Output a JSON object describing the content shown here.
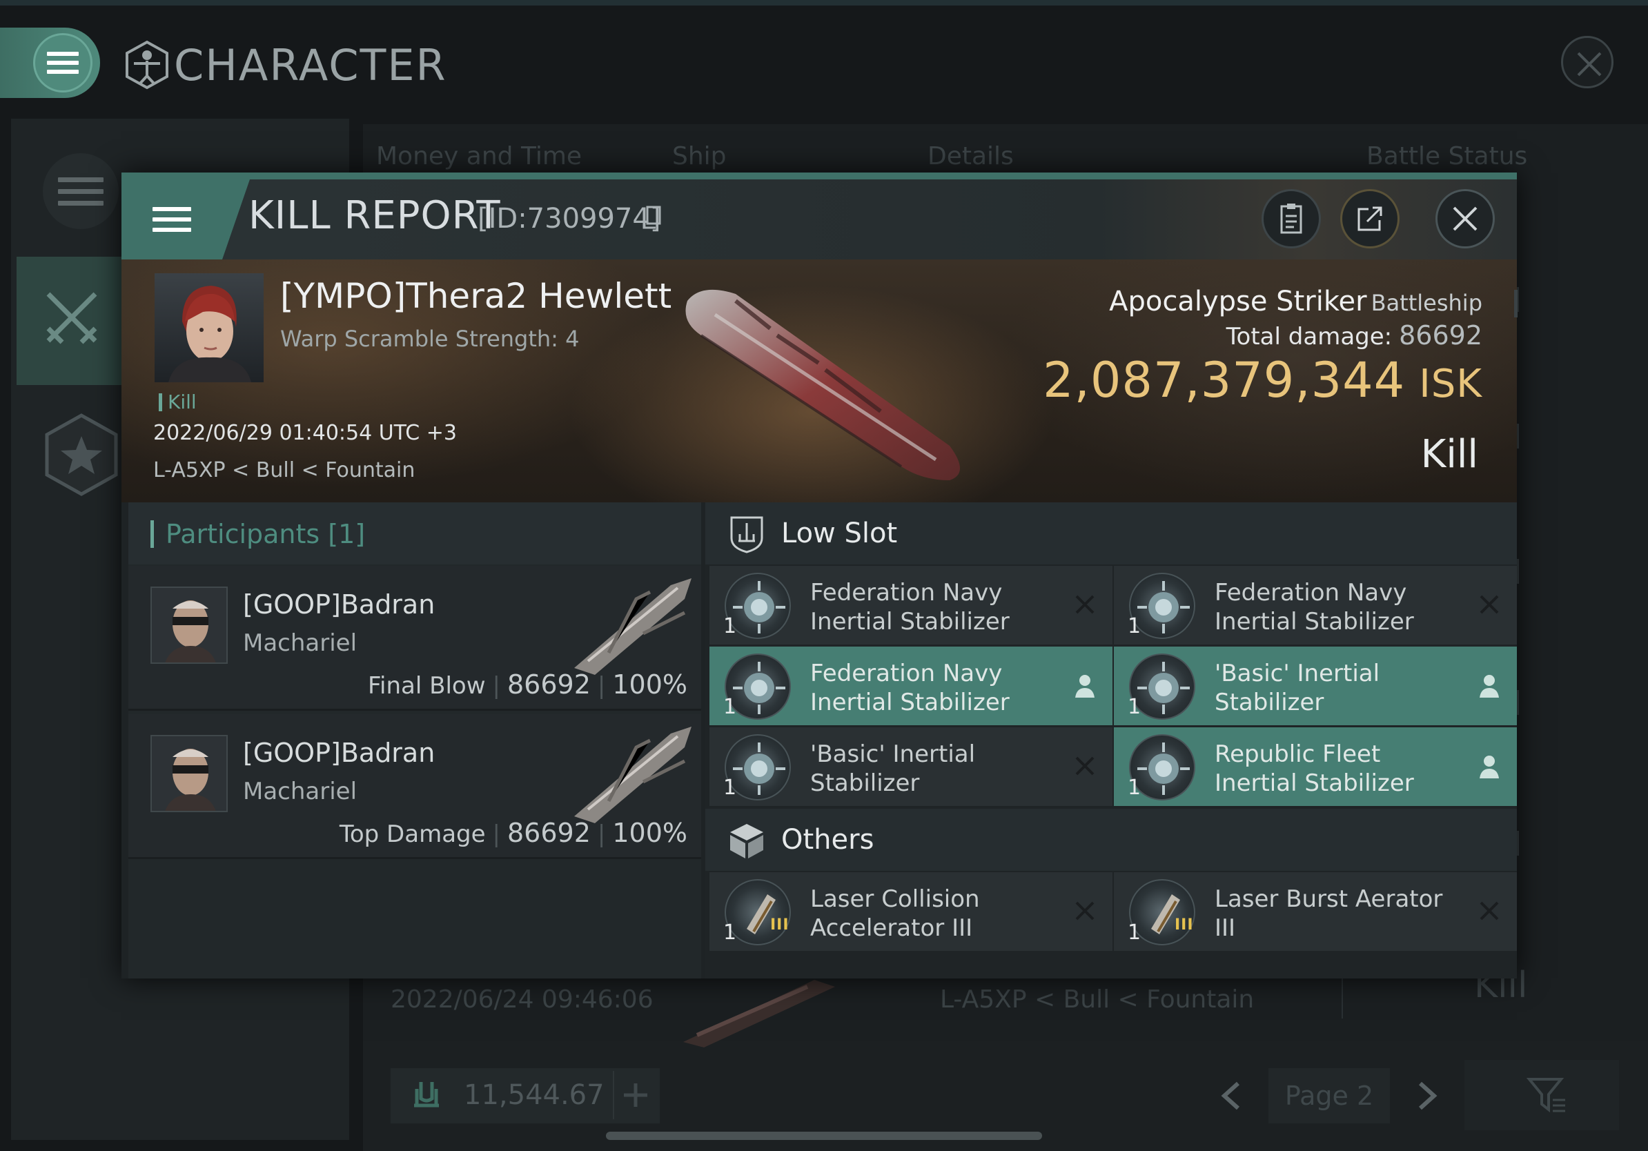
{
  "app": {
    "title": "CHARACTER",
    "tabs": [
      "Money and Time",
      "Ship",
      "Details",
      "Battle Status"
    ],
    "background_row": {
      "date": "2022/06/24  09:46:06",
      "location": "L-A5XP < Bull < Fountain",
      "result": "Kill"
    },
    "wallet_value": "11,544.67",
    "page_label": "Page 2"
  },
  "kill_report": {
    "title": "KILL REPORT",
    "id": "[ID:7309974]",
    "victim": {
      "name": "[YMPO]Thera2 Hewlett",
      "warp_scramble": "Warp Scramble Strength: 4",
      "tag": "Kill",
      "datetime": "2022/06/29 01:40:54 UTC +3",
      "location": "L-A5XP < Bull < Fountain"
    },
    "ship": {
      "name": "Apocalypse Striker",
      "class": "Battleship",
      "total_damage_label": "Total damage:",
      "total_damage": "86692",
      "isk_value": "2,087,379,344",
      "isk_unit": "ISK",
      "result": "Kill"
    },
    "participants": {
      "header": "Participants [1]",
      "rows": [
        {
          "name": "[GOOP]Badran",
          "ship": "Machariel",
          "role": "Final Blow",
          "damage": "86692",
          "percent": "100%"
        },
        {
          "name": "[GOOP]Badran",
          "ship": "Machariel",
          "role": "Top Damage",
          "damage": "86692",
          "percent": "100%"
        }
      ]
    },
    "low_slot": {
      "header": "Low Slot",
      "items": [
        {
          "qty": "1",
          "name": "Federation Navy Inertial Stabilizer",
          "status": "destroyed"
        },
        {
          "qty": "1",
          "name": "Federation Navy Inertial Stabilizer",
          "status": "destroyed"
        },
        {
          "qty": "1",
          "name": "Federation Navy Inertial Stabilizer",
          "status": "dropped"
        },
        {
          "qty": "1",
          "name": "'Basic' Inertial Stabilizer",
          "status": "dropped"
        },
        {
          "qty": "1",
          "name": "'Basic' Inertial Stabilizer",
          "status": "destroyed"
        },
        {
          "qty": "1",
          "name": "Republic Fleet Inertial Stabilizer",
          "status": "dropped"
        }
      ]
    },
    "others": {
      "header": "Others",
      "items": [
        {
          "qty": "1",
          "name": "Laser Collision Accelerator III",
          "tier": "III",
          "status": "destroyed"
        },
        {
          "qty": "1",
          "name": "Laser Burst Aerator III",
          "tier": "III",
          "status": "destroyed"
        }
      ]
    }
  },
  "colors": {
    "accent": "#4f8a7c",
    "dropped_bg": "#467e73",
    "isk_gold": "#e8c47c",
    "panel_bg": "#1e2325"
  }
}
